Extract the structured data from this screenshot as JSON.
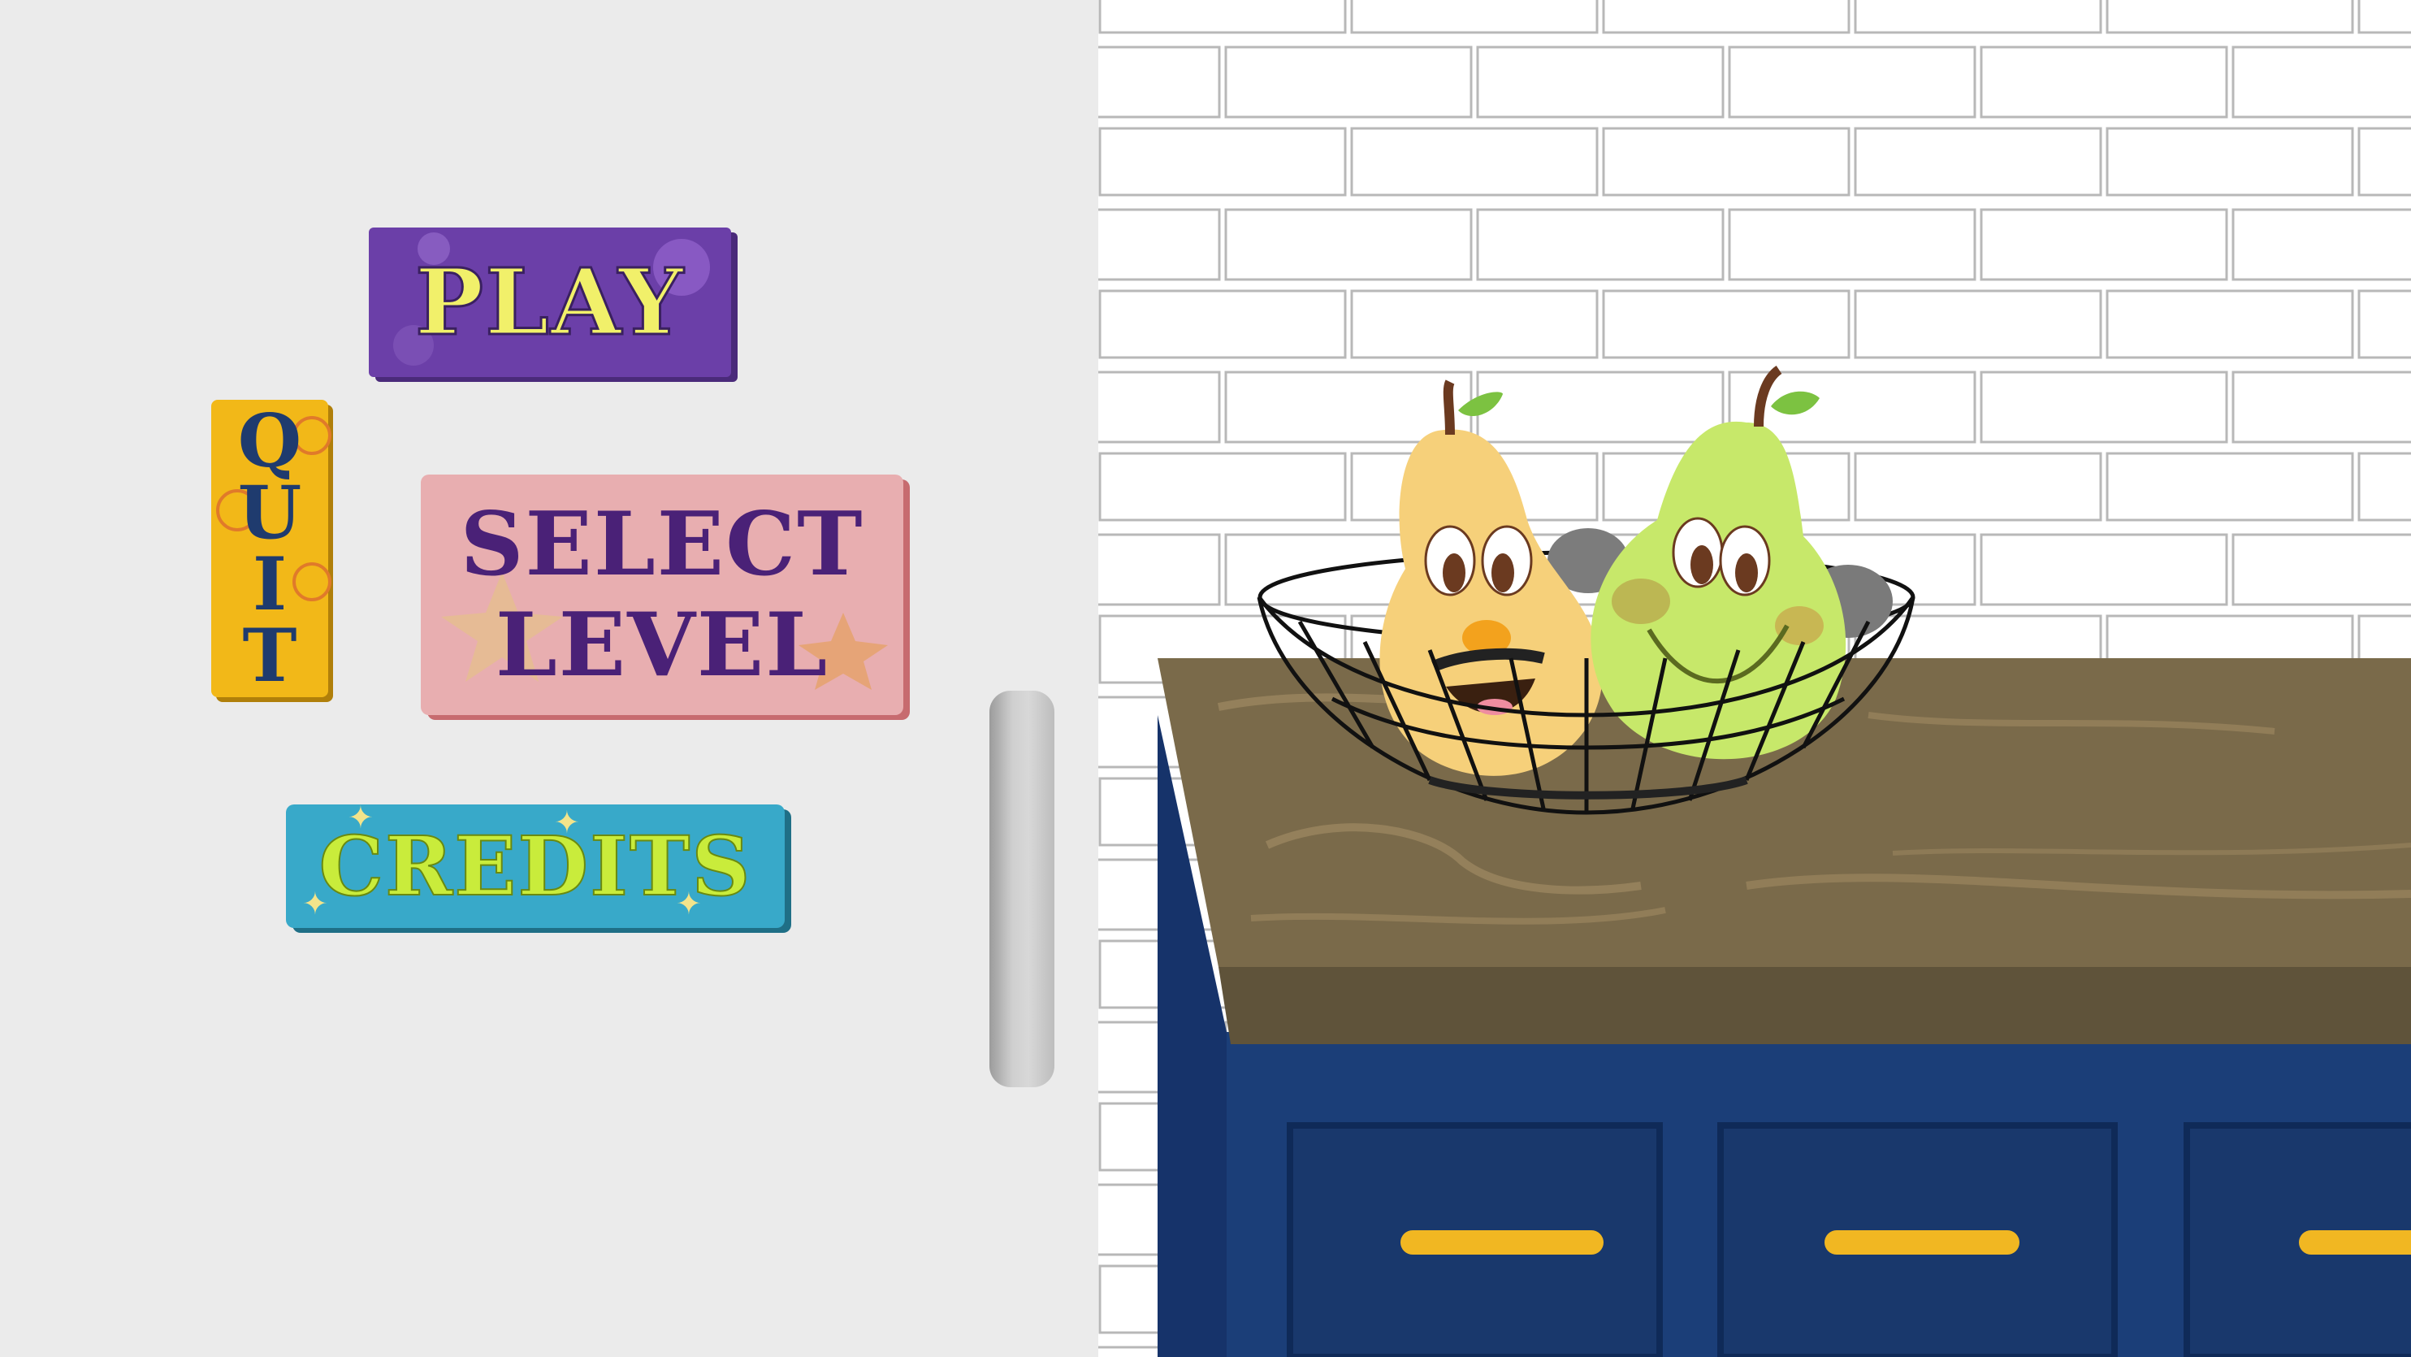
{
  "menu": {
    "play_label": "PLAY",
    "quit_letters": [
      "Q",
      "U",
      "I",
      "T"
    ],
    "select_line1": "SELECT",
    "select_line2": "LEVEL",
    "credits_label": "CREDITS"
  },
  "colors": {
    "play_bg": "#6b3fa8",
    "quit_bg": "#f2b818",
    "select_bg": "#e8aeb0",
    "credits_bg": "#38a9c9",
    "fridge": "#ebebeb",
    "counter_wood": "#7a6a4a",
    "cabinet_blue": "#1b3e78",
    "drawer_handle": "#f1b722"
  },
  "icons": {
    "pear_yellow": "pear-yellow-icon",
    "pear_green": "pear-green-icon",
    "basket": "wire-basket-icon"
  }
}
